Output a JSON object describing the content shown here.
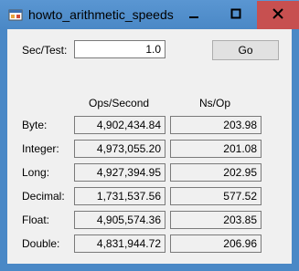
{
  "window": {
    "title": "howto_arithmetic_speeds",
    "icons": {
      "app": "app-form-icon",
      "minimize": "minimize-icon",
      "maximize": "maximize-icon",
      "close": "close-icon"
    },
    "colors": {
      "frame": "#4a88c6",
      "close_button": "#c75050",
      "client": "#f0f0f0"
    }
  },
  "form": {
    "sec_label": "Sec/Test:",
    "sec_value": "1.0",
    "go_label": "Go",
    "col_ops": "Ops/Second",
    "col_ns": "Ns/Op"
  },
  "rows": [
    {
      "label": "Byte:",
      "ops": "4,902,434.84",
      "ns": "203.98"
    },
    {
      "label": "Integer:",
      "ops": "4,973,055.20",
      "ns": "201.08"
    },
    {
      "label": "Long:",
      "ops": "4,927,394.95",
      "ns": "202.95"
    },
    {
      "label": "Decimal:",
      "ops": "1,731,537.56",
      "ns": "577.52"
    },
    {
      "label": "Float:",
      "ops": "4,905,574.36",
      "ns": "203.85"
    },
    {
      "label": "Double:",
      "ops": "4,831,944.72",
      "ns": "206.96"
    }
  ]
}
